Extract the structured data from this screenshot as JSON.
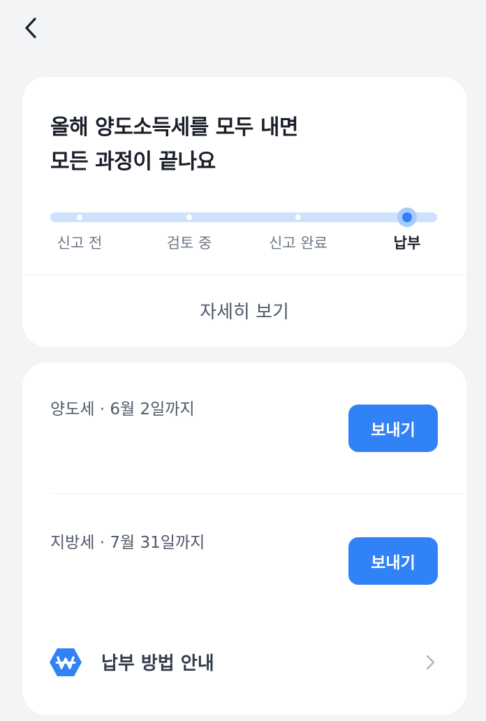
{
  "status_card": {
    "title_line1": "올해 양도소득세를 모두 내면",
    "title_line2": "모든 과정이 끝나요",
    "steps": [
      {
        "label": "신고 전"
      },
      {
        "label": "검토 중"
      },
      {
        "label": "신고 완료"
      },
      {
        "label": "납부"
      }
    ],
    "current_step_index": 3,
    "details_label": "자세히 보기"
  },
  "payment_card": {
    "items": [
      {
        "label": "양도세 · 6월 2일까지",
        "button_label": "보내기"
      },
      {
        "label": "지방세 · 7월 31일까지",
        "button_label": "보내기"
      }
    ],
    "guide_label": "납부 방법 안내"
  },
  "colors": {
    "accent": "#3182f6",
    "track": "#cfe2fd",
    "background": "#f2f4f6"
  },
  "icons": {
    "back": "chevron-left-icon",
    "won": "won-icon",
    "guide_arrow": "chevron-right-icon"
  }
}
